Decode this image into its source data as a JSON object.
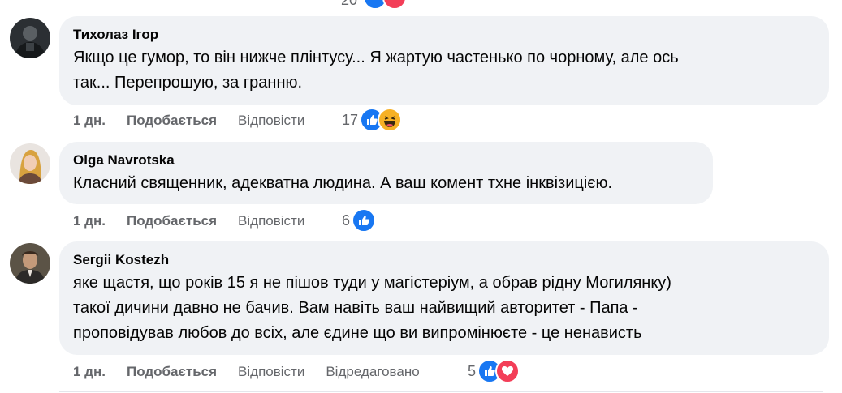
{
  "top_reaction_count": "20",
  "comments": [
    {
      "author": "Тихолаз Ігор",
      "text": "Якщо це гумор, то він нижче плінтусу... Я жартую частенько по чорному, але ось\nтак... Перепрошую, за гранню.",
      "time": "1 дн.",
      "like": "Подобається",
      "reply": "Відповісти",
      "reactions_count": "17",
      "reactions": [
        "like-icon",
        "haha-icon"
      ]
    },
    {
      "author": "Olga Navrotska",
      "text": "Класний священник, адекватна людина. А ваш комент тхне інквізицією.",
      "time": "1 дн.",
      "like": "Подобається",
      "reply": "Відповісти",
      "reactions_count": "6",
      "reactions": [
        "like-icon"
      ]
    },
    {
      "author": "Sergii Kostezh",
      "text": "яке щастя, що років 15 я не пішов туди у магістеріум, а обрав рідну Могилянку)\nтакої дичини давно не бачив. Вам навіть ваш найвищий авторитет - Папа -\nпроповідував любов до всіх, але єдине що ви випромінюєте - це ненависть",
      "time": "1 дн.",
      "like": "Подобається",
      "reply": "Відповісти",
      "edited": "Відредаговано",
      "reactions_count": "5",
      "reactions": [
        "like-icon",
        "love-icon"
      ]
    }
  ]
}
